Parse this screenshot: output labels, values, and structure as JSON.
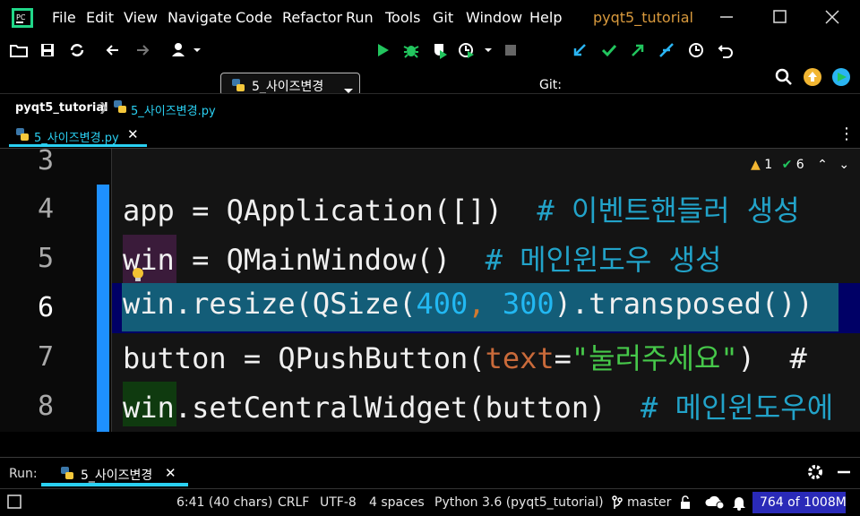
{
  "titlebar": {
    "menu": [
      "File",
      "Edit",
      "View",
      "Navigate",
      "Code",
      "Refactor",
      "Run",
      "Tools",
      "Git",
      "Window",
      "Help"
    ],
    "project_title": "pyqt5_tutorial"
  },
  "toolbar": {
    "run_config": "5_사이즈변경",
    "git_label": "Git:"
  },
  "breadcrumb": {
    "project": "pyqt5_tutorial",
    "file": "5_사이즈변경.py"
  },
  "tabs": [
    {
      "label": "5_사이즈변경.py",
      "active": true
    }
  ],
  "editor": {
    "line_numbers": [
      "3",
      "4",
      "5",
      "6",
      "7",
      "8"
    ],
    "active_line": "6",
    "inspection": {
      "warnings": "1",
      "weak_warnings": "6"
    },
    "lines": {
      "l4": {
        "code": "app = QApplication([])  ",
        "comment": "# 이벤트핸들러 생성"
      },
      "l5": {
        "code": "win",
        "rest": " = QMainWindow()  ",
        "comment": "# 메인윈도우 생성"
      },
      "l6": {
        "a": "win.resize(QSize(",
        "n1": "400",
        "comma": ",",
        "sp": " ",
        "n2": "300",
        "b": ").transposed())"
      },
      "l7": {
        "a": "button = QPushButton(",
        "kw": "text",
        "eq": "=",
        "str": "\"눌러주세요\"",
        "b": ")  #"
      },
      "l8": {
        "a": "win",
        "b": ".setCentralWidget(button)  ",
        "comment": "# 메인윈도우에"
      }
    }
  },
  "run": {
    "label": "Run:",
    "tab": "5_사이즈변경"
  },
  "statusbar": {
    "position": "6:41 (40 chars)",
    "line_sep": "CRLF",
    "encoding": "UTF-8",
    "indent": "4 spaces",
    "interpreter": "Python 3.6 (pyqt5_tutorial)",
    "branch": "master",
    "memory": "764 of 1008M"
  },
  "colors": {
    "accent": "#2ad0f2",
    "selection": "#135d78",
    "active_line": "#000066",
    "change_bar": "#1e90ff"
  }
}
